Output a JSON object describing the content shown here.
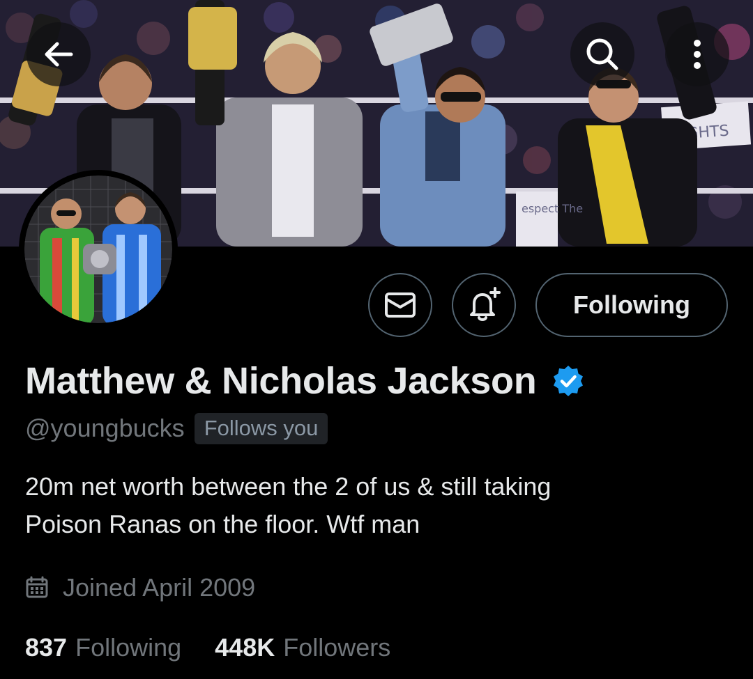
{
  "header": {
    "back_icon": "arrow-left-icon",
    "search_icon": "search-icon",
    "more_icon": "more-vertical-icon"
  },
  "banner": {
    "sign_text": "RIGHTS",
    "sign2_text": "espect The"
  },
  "actions": {
    "message_icon": "envelope-icon",
    "notify_icon": "bell-plus-icon",
    "following_label": "Following"
  },
  "profile": {
    "display_name": "Matthew & Nicholas Jackson",
    "verified": true,
    "handle": "@youngbucks",
    "follows_you_label": "Follows you",
    "bio_line1": "20m net worth between the 2 of us & still taking",
    "bio_line2": "Poison Ranas on the floor. Wtf man",
    "joined": "Joined April 2009",
    "joined_icon": "calendar-icon"
  },
  "stats": {
    "following_count": "837",
    "following_label": "Following",
    "followers_count": "448K",
    "followers_label": "Followers"
  },
  "colors": {
    "background": "#000000",
    "text_primary": "#e7e9ea",
    "text_secondary": "#71767b",
    "border": "#536471",
    "verified_blue": "#1d9bf0"
  }
}
